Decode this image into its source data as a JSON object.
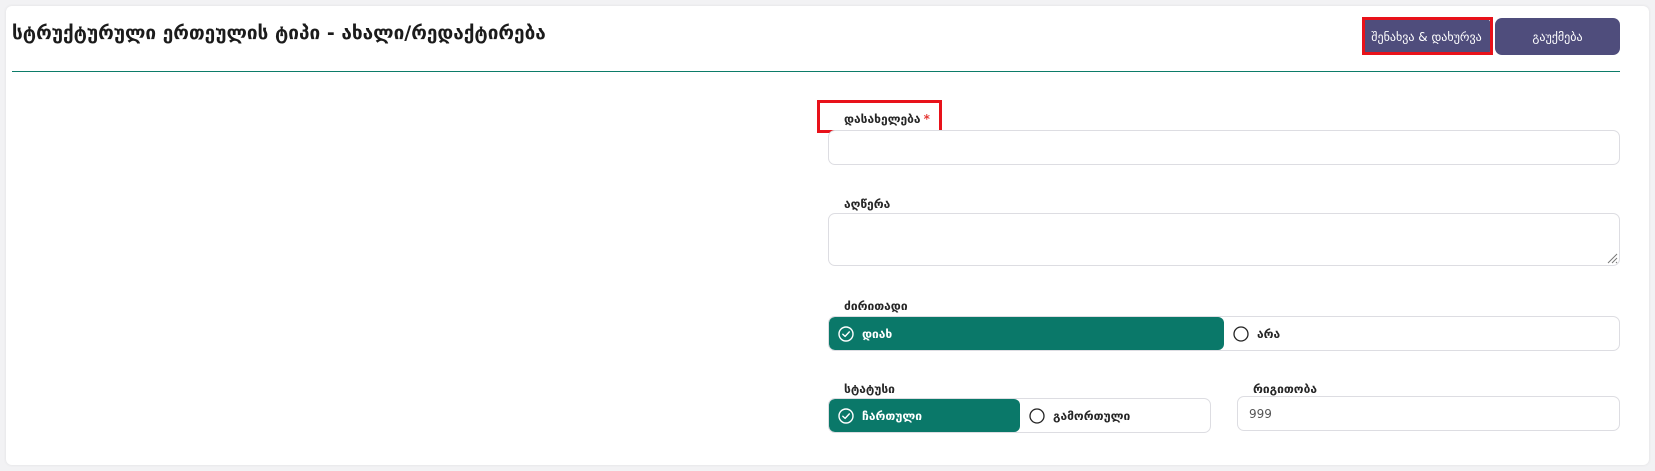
{
  "header": {
    "title": "სტრუქტურული ერთეულის ტიპი - ახალი/რედაქტირება",
    "save_close_label": "შენახვა & დახურვა",
    "cancel_label": "გაუქმება"
  },
  "form": {
    "name": {
      "label": "დასახელება",
      "required_mark": "*",
      "value": ""
    },
    "description": {
      "label": "აღწერა",
      "value": ""
    },
    "main": {
      "label": "ძირითადი",
      "options": [
        "დიახ",
        "არა"
      ],
      "selected": "დიახ"
    },
    "status": {
      "label": "სტატუსი",
      "options": [
        "ჩართული",
        "გამორთული"
      ],
      "selected": "ჩართული"
    },
    "order": {
      "label": "რიგითობა",
      "value": "999"
    }
  },
  "colors": {
    "accent": "#0a7869",
    "button": "#4f4d7c",
    "highlight": "#e8121a",
    "required": "#e53935"
  }
}
